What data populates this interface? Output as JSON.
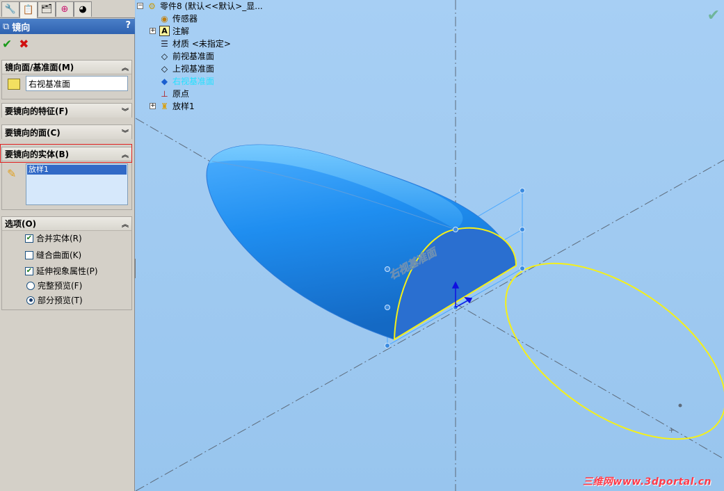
{
  "panel": {
    "tabs": [
      "featuremanager-icon",
      "propertymanager-icon",
      "configuration-icon",
      "dimxpert-icon",
      "display-icon"
    ],
    "title": "镜向",
    "help": "?",
    "ok_icon": "checkmark-icon",
    "cancel_icon": "x-icon",
    "mirror_plane": {
      "header": "镜向面/基准面(M)",
      "value": "右视基准面"
    },
    "features_to_mirror": {
      "header": "要镜向的特征(F)"
    },
    "faces_to_mirror": {
      "header": "要镜向的面(C)"
    },
    "bodies_to_mirror": {
      "header": "要镜向的实体(B)",
      "items": [
        "放样1"
      ]
    },
    "options": {
      "header": "选项(O)",
      "merge_solids": {
        "label": "合并实体(R)",
        "checked": true
      },
      "knit_surfaces": {
        "label": "缝合曲面(K)",
        "checked": false
      },
      "propagate_visual": {
        "label": "延伸视象属性(P)",
        "checked": true
      },
      "full_preview": {
        "label": "完整预览(F)",
        "selected": false
      },
      "partial_preview": {
        "label": "部分预览(T)",
        "selected": true
      }
    }
  },
  "tree": {
    "root": "零件8  (默认<<默认>_显...",
    "items": [
      {
        "label": "传感器",
        "icon": "sensor-icon",
        "expandable": false
      },
      {
        "label": "注解",
        "icon": "annotation-icon",
        "expandable": true
      },
      {
        "label": "材质 <未指定>",
        "icon": "material-icon",
        "expandable": false
      },
      {
        "label": "前视基准面",
        "icon": "plane-icon",
        "expandable": false
      },
      {
        "label": "上视基准面",
        "icon": "plane-icon",
        "expandable": false
      },
      {
        "label": "右视基准面",
        "icon": "plane-icon",
        "expandable": false,
        "selected": true
      },
      {
        "label": "原点",
        "icon": "origin-icon",
        "expandable": false
      },
      {
        "label": "放样1",
        "icon": "loft-icon",
        "expandable": true
      }
    ]
  },
  "viewport": {
    "plane_label": "右视基准面",
    "watermark": "三维网www.3dportal.cn"
  },
  "colors": {
    "body": "#1f8ef0",
    "body_dark": "#1770d0",
    "section_face": "#2a6fd0",
    "edge_yellow": "#f5f018",
    "background": "#9ec7ee",
    "axis": "#5d6b7b"
  }
}
